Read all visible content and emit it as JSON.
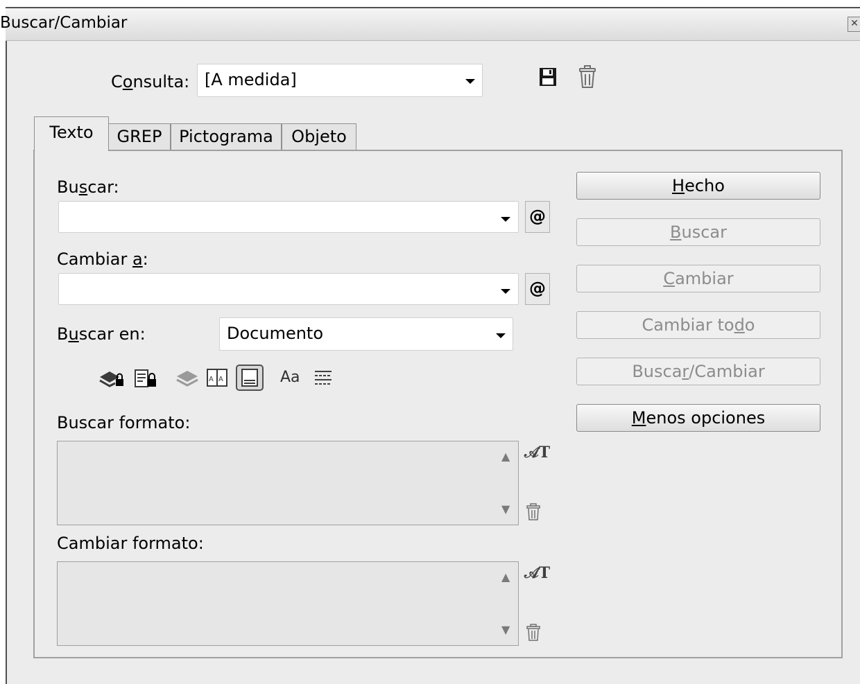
{
  "window": {
    "title": "Buscar/Cambiar"
  },
  "query": {
    "label_prefix": "C",
    "label_ul": "o",
    "label_suffix": "nsulta:",
    "value": "[A medida]"
  },
  "tabs": [
    {
      "label": "Texto",
      "active": true
    },
    {
      "label": "GREP",
      "active": false
    },
    {
      "label": "Pictograma",
      "active": false
    },
    {
      "label": "Objeto",
      "active": false
    }
  ],
  "find": {
    "label_prefix": "Bu",
    "label_ul": "s",
    "label_suffix": "car:",
    "value": ""
  },
  "change": {
    "label_prefix": "Cambiar ",
    "label_ul": "a",
    "label_suffix": ":",
    "value": ""
  },
  "search_in": {
    "label_prefix": "B",
    "label_ul": "u",
    "label_suffix": "scar en:",
    "value": "Documento"
  },
  "find_format": {
    "label": "Buscar formato:"
  },
  "change_format": {
    "label": "Cambiar formato:"
  },
  "buttons": {
    "done": {
      "ul": "H",
      "rest": "echo"
    },
    "find": {
      "ul": "B",
      "rest": "uscar"
    },
    "change": {
      "ul": "C",
      "rest": "ambiar"
    },
    "change_all": {
      "pre": "Cambiar to",
      "ul": "d",
      "rest": "o"
    },
    "find_change": {
      "pre": "Busca",
      "ul": "r",
      "rest": "/Cambiar"
    },
    "fewer_options": {
      "ul": "M",
      "rest": "enos opciones"
    }
  },
  "special_char_glyph": "@",
  "case_option_glyph": "Aa",
  "icons": [
    "save-query-icon",
    "delete-query-icon",
    "special-characters-icon",
    "include-locked-layers-icon",
    "include-locked-stories-icon",
    "include-hidden-layers-icon",
    "include-master-pages-icon",
    "include-footnotes-icon",
    "case-sensitive-icon",
    "whole-word-icon",
    "format-icon",
    "trash-icon"
  ],
  "colors": {
    "dialog_bg": "#ececec",
    "disabled_text": "#8c8c8c"
  }
}
